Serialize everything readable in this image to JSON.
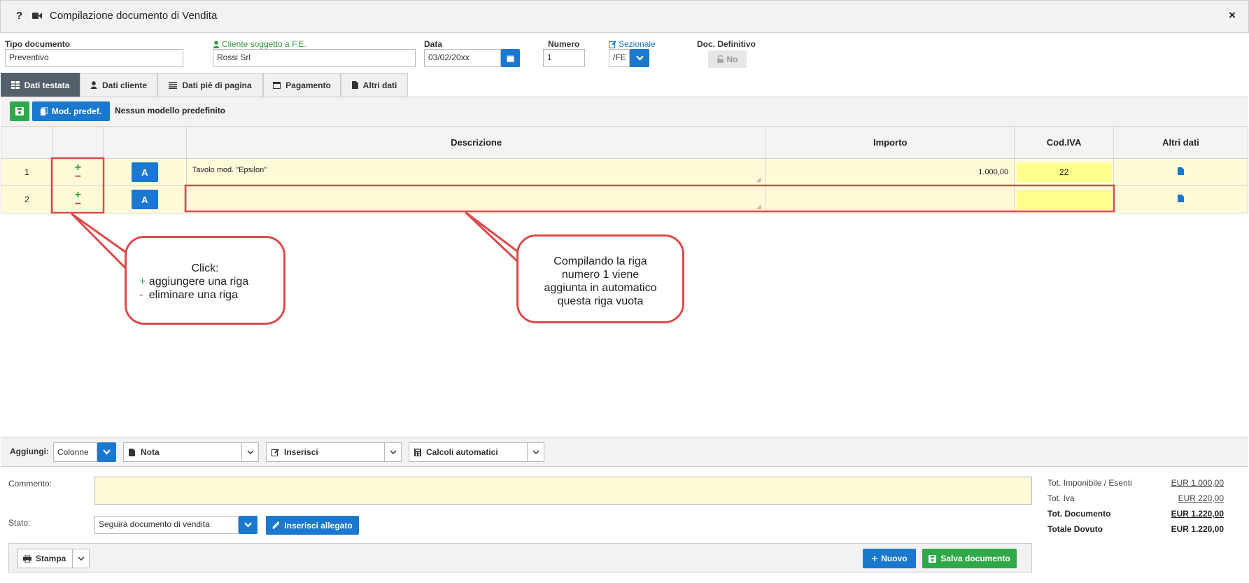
{
  "window": {
    "title": "Compilazione documento di Vendita",
    "help_glyph": "?",
    "close_glyph": "×"
  },
  "header": {
    "tipo_documento": {
      "label": "Tipo documento",
      "value": "Preventivo"
    },
    "cliente": {
      "label": "Cliente soggetto a F.E.",
      "value": "Rossi Srl"
    },
    "data": {
      "label": "Data",
      "value": "03/02/20xx"
    },
    "numero": {
      "label": "Numero",
      "value": "1"
    },
    "sezionale": {
      "label": "Sezionale",
      "value": "/FE"
    },
    "doc_definitivo": {
      "label": "Doc. Definitivo",
      "value": "No"
    }
  },
  "tabs": [
    {
      "label": "Dati testata",
      "icon": "table-icon"
    },
    {
      "label": "Dati cliente",
      "icon": "user-icon"
    },
    {
      "label": "Dati piè di pagina",
      "icon": "list-icon"
    },
    {
      "label": "Pagamento",
      "icon": "calendar-icon"
    },
    {
      "label": "Altri dati",
      "icon": "document-icon"
    }
  ],
  "toolbar": {
    "mod_predef_label": "Mod. predef.",
    "modello_text": "Nessun modello predefinito"
  },
  "grid": {
    "columns": [
      "Descrizione",
      "Importo",
      "Cod.IVA",
      "Altri dati"
    ],
    "row_button_label": "A",
    "plus_glyph": "+",
    "minus_glyph": "−",
    "rows": [
      {
        "num": "1",
        "descrizione": "Tavolo mod. \"Epsilon\"",
        "importo": "1.000,00",
        "cod_iva": "22"
      },
      {
        "num": "2",
        "descrizione": "",
        "importo": "",
        "cod_iva": ""
      }
    ]
  },
  "callouts": {
    "left": {
      "title": "Click:",
      "plus_sym": "+",
      "plus_text": "aggiungere una riga",
      "minus_sym": "-",
      "minus_text": "eliminare una riga"
    },
    "right": {
      "line1": "Compilando la riga",
      "line2": "numero 1 viene",
      "line3": "aggiunta in automatico",
      "line4": "questa riga vuota"
    }
  },
  "aggiungi_bar": {
    "label": "Aggiungi:",
    "colonne": "Colonne",
    "nota": "Nota",
    "inserisci": "Inserisci",
    "calcoli": "Calcoli automatici"
  },
  "footer": {
    "commento_label": "Commento:",
    "commento_value": "",
    "stato_label": "Stato:",
    "stato_value": "Seguirà documento di vendita",
    "inserisci_allegato": "Inserisci allegato",
    "stampa": "Stampa",
    "nuovo": "Nuovo",
    "salva": "Salva documento"
  },
  "totals": [
    {
      "label": "Tot. Imponibile / Esenti",
      "value": "EUR 1.000,00",
      "bold": false
    },
    {
      "label": "Tot. Iva",
      "value": "EUR 220,00",
      "bold": false
    },
    {
      "label": "Tot. Documento",
      "value": "EUR 1.220,00",
      "bold": true
    },
    {
      "label": "Totale Dovuto",
      "value": "EUR 1.220,00",
      "bold": true
    }
  ],
  "colors": {
    "accent_blue": "#1a78cf",
    "green": "#2fa84a",
    "active_tab": "#54606c",
    "annotation_red": "#dd4a4a",
    "row_yellow": "#fffbd8",
    "iva_yellow": "#ffff8c"
  }
}
